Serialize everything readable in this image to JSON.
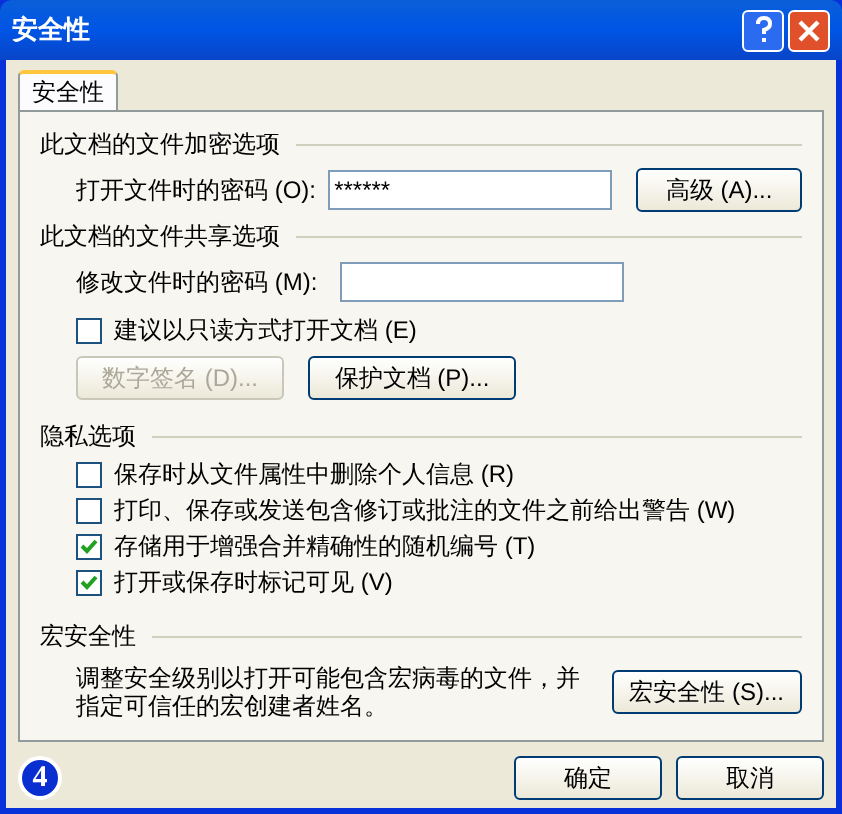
{
  "window": {
    "title": "安全性"
  },
  "tabs": [
    {
      "label": "安全性",
      "selected": true
    }
  ],
  "encryption": {
    "title": "此文档的文件加密选项",
    "password_label": "打开文件时的密码 (O):",
    "password_value": "******",
    "advanced_button": "高级 (A)..."
  },
  "sharing": {
    "title": "此文档的文件共享选项",
    "password_label": "修改文件时的密码 (M):",
    "read_only": {
      "label": "建议以只读方式打开文档 (E)",
      "checked": false
    },
    "buttons": [
      {
        "label": "数字签名 (D)...",
        "disabled": true
      },
      {
        "label": "保护文档 (P)...",
        "disabled": false
      }
    ]
  },
  "privacy": {
    "title": "隐私选项",
    "options": [
      {
        "label": "保存时从文件属性中删除个人信息 (R)",
        "checked": false
      },
      {
        "label": "打印、保存或发送包含修订或批注的文件之前给出警告 (W)",
        "checked": false
      },
      {
        "label": "存储用于增强合并精确性的随机编号 (T)",
        "checked": true
      },
      {
        "label": "打开或保存时标记可见 (V)",
        "checked": true
      }
    ]
  },
  "macro": {
    "title": "宏安全性",
    "description": "调整安全级别以打开可能包含宏病毒的文件，并指定可信任的宏创建者姓名。",
    "button": "宏安全性 (S)..."
  },
  "badge": "4",
  "buttons": [
    "确定",
    "取消"
  ]
}
